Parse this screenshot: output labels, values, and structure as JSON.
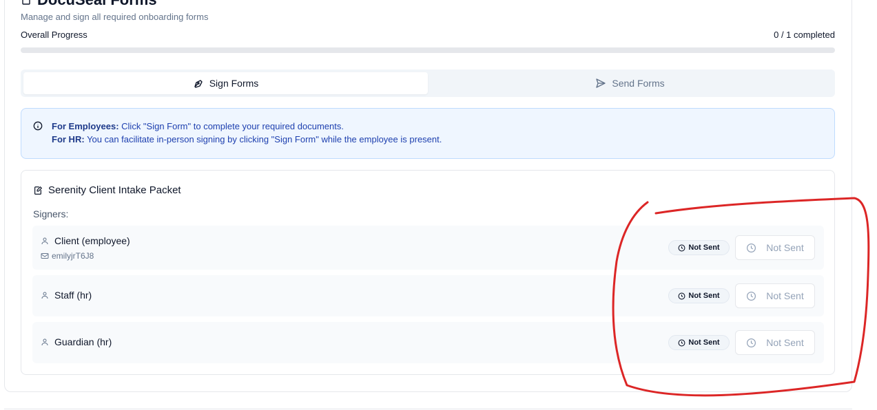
{
  "header": {
    "title": "DocuSeal Forms",
    "subtitle": "Manage and sign all required onboarding forms"
  },
  "progress": {
    "label": "Overall Progress",
    "count_text": "0 / 1 completed",
    "completed": 0,
    "total": 1
  },
  "tabs": [
    {
      "label": "Sign Forms",
      "active": true,
      "icon": "pen-nib-icon"
    },
    {
      "label": "Send Forms",
      "active": false,
      "icon": "send-icon"
    }
  ],
  "info": {
    "employees_label": "For Employees:",
    "employees_text": "Click \"Sign Form\" to complete your required documents.",
    "hr_label": "For HR:",
    "hr_text": "You can facilitate in-person signing by clicking \"Sign Form\" while the employee is present."
  },
  "packet": {
    "title": "Serenity Client Intake Packet",
    "signers_label": "Signers:",
    "signers": [
      {
        "name": "Client (employee)",
        "email": "emilyjrT6J8",
        "badge": "Not Sent",
        "status": "Not Sent"
      },
      {
        "name": "Staff (hr)",
        "badge": "Not Sent",
        "status": "Not Sent"
      },
      {
        "name": "Guardian (hr)",
        "badge": "Not Sent",
        "status": "Not Sent"
      }
    ]
  },
  "colors": {
    "annotation": "#dc2626",
    "info_bg": "#eff6ff",
    "info_text": "#1e40af"
  }
}
